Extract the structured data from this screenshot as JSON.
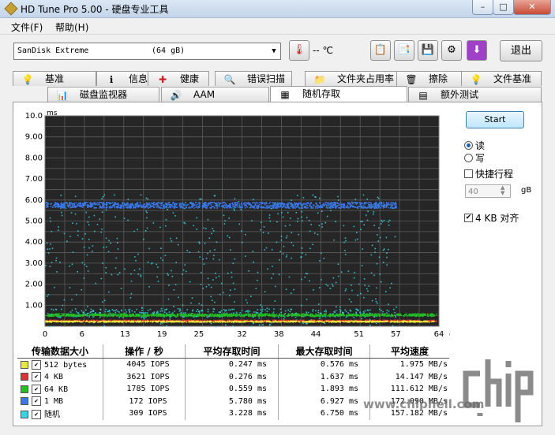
{
  "window": {
    "title": "HD Tune Pro 5.00 - 硬盘专业工具",
    "minimize": "–",
    "restore": "□",
    "close": "✕"
  },
  "menu": {
    "file": "文件(F)",
    "help": "帮助(H)"
  },
  "toolbar": {
    "drive_name": "SanDisk Extreme",
    "drive_size": "(64 gB)",
    "temperature": "-- ℃",
    "exit": "退出"
  },
  "tabs_top": [
    {
      "label": "基准",
      "icon": "benchmark-icon"
    },
    {
      "label": "信息",
      "icon": "info-icon"
    },
    {
      "label": "健康",
      "icon": "health-icon"
    },
    {
      "label": "错误扫描",
      "icon": "magnifier-icon"
    },
    {
      "label": "文件夹占用率",
      "icon": "folder-icon"
    },
    {
      "label": "擦除",
      "icon": "trash-icon"
    },
    {
      "label": "文件基准",
      "icon": "file-benchmark-icon"
    }
  ],
  "tabs_bottom": [
    {
      "label": "磁盘监视器",
      "icon": "monitor-icon"
    },
    {
      "label": "AAM",
      "icon": "speaker-icon"
    },
    {
      "label": "随机存取",
      "icon": "random-access-icon"
    },
    {
      "label": "额外测试",
      "icon": "extra-test-icon"
    }
  ],
  "controls": {
    "start": "Start",
    "read": "读",
    "write": "写",
    "quick_stroke": "快捷行程",
    "stroke_value": "40",
    "stroke_unit": "gB",
    "align": "4 KB 对齐"
  },
  "chart_data": {
    "type": "scatter",
    "ylabel": "ms",
    "xunit": "gB",
    "xlim": [
      0,
      64
    ],
    "ylim": [
      0,
      10
    ],
    "x_ticks": [
      0,
      6,
      13,
      19,
      25,
      32,
      38,
      44,
      51,
      57,
      64
    ],
    "y_ticks": [
      "1.00",
      "2.00",
      "3.00",
      "4.00",
      "5.00",
      "6.00",
      "7.00",
      "8.00",
      "9.00",
      "10.0"
    ],
    "grid": true,
    "series": [
      {
        "name": "512 bytes",
        "color": "#e8e83a",
        "band_ms": 0.25
      },
      {
        "name": "4 KB",
        "color": "#e03030",
        "band_ms": 0.28
      },
      {
        "name": "64 KB",
        "color": "#22c022",
        "band_ms": 0.56
      },
      {
        "name": "1 MB",
        "color": "#3a78e8",
        "band_ms": 5.78
      },
      {
        "name": "随机",
        "color": "#30d8e8",
        "band_ms": 3.23
      }
    ]
  },
  "results": {
    "headers": [
      "传输数据大小",
      "操作 / 秒",
      "平均存取时间",
      "最大存取时间",
      "平均速度"
    ],
    "rows": [
      {
        "size": "512 bytes",
        "ops": "4045 IOPS",
        "avg": "0.247 ms",
        "max": "0.576 ms",
        "speed": "1.975 MB/s",
        "color": "#e8e83a"
      },
      {
        "size": "4 KB",
        "ops": "3621 IOPS",
        "avg": "0.276 ms",
        "max": "1.637 ms",
        "speed": "14.147 MB/s",
        "color": "#e03030"
      },
      {
        "size": "64 KB",
        "ops": "1785 IOPS",
        "avg": "0.559 ms",
        "max": "1.893 ms",
        "speed": "111.612 MB/s",
        "color": "#22c022"
      },
      {
        "size": "1 MB",
        "ops": "172 IOPS",
        "avg": "5.780 ms",
        "max": "6.927 ms",
        "speed": "172.090 MB/s",
        "color": "#3a78e8"
      },
      {
        "size": "随机",
        "ops": "309 IOPS",
        "avg": "3.228 ms",
        "max": "6.750 ms",
        "speed": "157.182 MB/s",
        "color": "#30d8e8"
      }
    ]
  },
  "watermark": {
    "logo": "chip hell",
    "url": "www.chiphell.com"
  }
}
